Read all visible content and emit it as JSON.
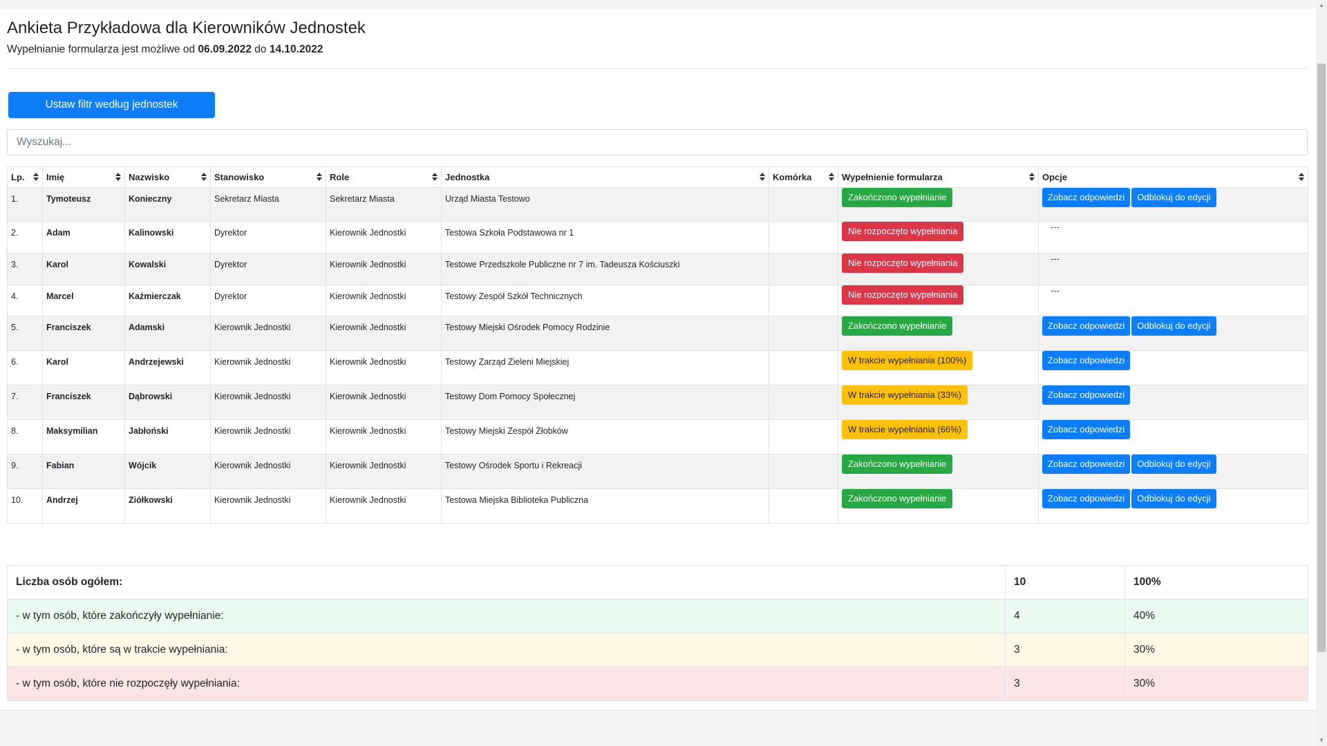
{
  "header": {
    "title": "Ankieta Przykładowa dla Kierowników Jednostek",
    "subtitle_prefix": "Wypełnianie formularza jest możliwe od",
    "date_from": "06.09.2022",
    "subtitle_mid": "do",
    "date_to": "14.10.2022"
  },
  "filter_button": "Ustaw filtr według jednostek",
  "search": {
    "placeholder": "Wyszukaj..."
  },
  "table": {
    "columns": [
      "Lp.",
      "Imię",
      "Nazwisko",
      "Stanowisko",
      "Role",
      "Jednostka",
      "Komórka",
      "Wypełnienie formularza",
      "Opcje"
    ],
    "rows": [
      {
        "lp": "1.",
        "imie": "Tymoteusz",
        "nazwisko": "Konieczny",
        "stanowisko": "Sekretarz Miasta",
        "role": "Sekretarz Miasta",
        "jednostka": "Urząd Miasta Testowo",
        "komorka": "",
        "status": "Zakończono wypełnianie",
        "status_color": "green",
        "view": "Zobacz odpowiedzi",
        "unlock": "Odblokuj do edycji",
        "dash": ""
      },
      {
        "lp": "2.",
        "imie": "Adam",
        "nazwisko": "Kalinowski",
        "stanowisko": "Dyrektor",
        "role": "Kierownik Jednostki",
        "jednostka": "Testowa Szkoła Podstawowa nr 1",
        "komorka": "",
        "status": "Nie rozpoczęto wypełniania",
        "status_color": "red",
        "view": "",
        "unlock": "",
        "dash": "---"
      },
      {
        "lp": "3.",
        "imie": "Karol",
        "nazwisko": "Kowalski",
        "stanowisko": "Dyrektor",
        "role": "Kierownik Jednostki",
        "jednostka": "Testowe Przedszkole Publiczne nr 7 im. Tadeusza Kościuszki",
        "komorka": "",
        "status": "Nie rozpoczęto wypełniania",
        "status_color": "red",
        "view": "",
        "unlock": "",
        "dash": "---"
      },
      {
        "lp": "4.",
        "imie": "Marcel",
        "nazwisko": "Kaźmierczak",
        "stanowisko": "Dyrektor",
        "role": "Kierownik Jednostki",
        "jednostka": "Testowy Zespół Szkół Technicznych",
        "komorka": "",
        "status": "Nie rozpoczęto wypełniania",
        "status_color": "red",
        "view": "",
        "unlock": "",
        "dash": "---"
      },
      {
        "lp": "5.",
        "imie": "Franciszek",
        "nazwisko": "Adamski",
        "stanowisko": "Kierownik Jednostki",
        "role": "Kierownik Jednostki",
        "jednostka": "Testowy Miejski Ośrodek Pomocy Rodzinie",
        "komorka": "",
        "status": "Zakończono wypełnianie",
        "status_color": "green",
        "view": "Zobacz odpowiedzi",
        "unlock": "Odblokuj do edycji",
        "dash": ""
      },
      {
        "lp": "6.",
        "imie": "Karol",
        "nazwisko": "Andrzejewski",
        "stanowisko": "Kierownik Jednostki",
        "role": "Kierownik Jednostki",
        "jednostka": "Testowy Zarząd Zieleni Miejskiej",
        "komorka": "",
        "status": "W trakcie wypełniania (100%)",
        "status_color": "yellow",
        "view": "Zobacz odpowiedzi",
        "unlock": "",
        "dash": ""
      },
      {
        "lp": "7.",
        "imie": "Franciszek",
        "nazwisko": "Dąbrowski",
        "stanowisko": "Kierownik Jednostki",
        "role": "Kierownik Jednostki",
        "jednostka": "Testowy Dom Pomocy Społecznej",
        "komorka": "",
        "status": "W trakcie wypełniania (33%)",
        "status_color": "yellow",
        "view": "Zobacz odpowiedzi",
        "unlock": "",
        "dash": ""
      },
      {
        "lp": "8.",
        "imie": "Maksymilian",
        "nazwisko": "Jabłoński",
        "stanowisko": "Kierownik Jednostki",
        "role": "Kierownik Jednostki",
        "jednostka": "Testowy Miejski Zespół Żłobków",
        "komorka": "",
        "status": "W trakcie wypełniania (66%)",
        "status_color": "yellow",
        "view": "Zobacz odpowiedzi",
        "unlock": "",
        "dash": ""
      },
      {
        "lp": "9.",
        "imie": "Fabian",
        "nazwisko": "Wójcik",
        "stanowisko": "Kierownik Jednostki",
        "role": "Kierownik Jednostki",
        "jednostka": "Testowy Ośrodek Sportu i Rekreacji",
        "komorka": "",
        "status": "Zakończono wypełnianie",
        "status_color": "green",
        "view": "Zobacz odpowiedzi",
        "unlock": "Odblokuj do edycji",
        "dash": ""
      },
      {
        "lp": "10.",
        "imie": "Andrzej",
        "nazwisko": "Ziółkowski",
        "stanowisko": "Kierownik Jednostki",
        "role": "Kierownik Jednostki",
        "jednostka": "Testowa Miejska Biblioteka Publiczna",
        "komorka": "",
        "status": "Zakończono wypełnianie",
        "status_color": "green",
        "view": "Zobacz odpowiedzi",
        "unlock": "Odblokuj do edycji",
        "dash": ""
      }
    ]
  },
  "summary": {
    "total_label": "Liczba osób ogółem:",
    "total_count": "10",
    "total_pct": "100%",
    "done_label": "- w tym osób, które zakończyły wypełnianie:",
    "done_count": "4",
    "done_pct": "40%",
    "progress_label": "- w tym osób, które są w trakcie wypełniania:",
    "progress_count": "3",
    "progress_pct": "30%",
    "notstarted_label": "- w tym osób, które nie rozpoczęły wypełniania:",
    "notstarted_count": "3",
    "notstarted_pct": "30%"
  },
  "colors": {
    "primary": "#0d7ef8",
    "success": "#28a745",
    "danger": "#dc3545",
    "warning": "#ffc107"
  }
}
